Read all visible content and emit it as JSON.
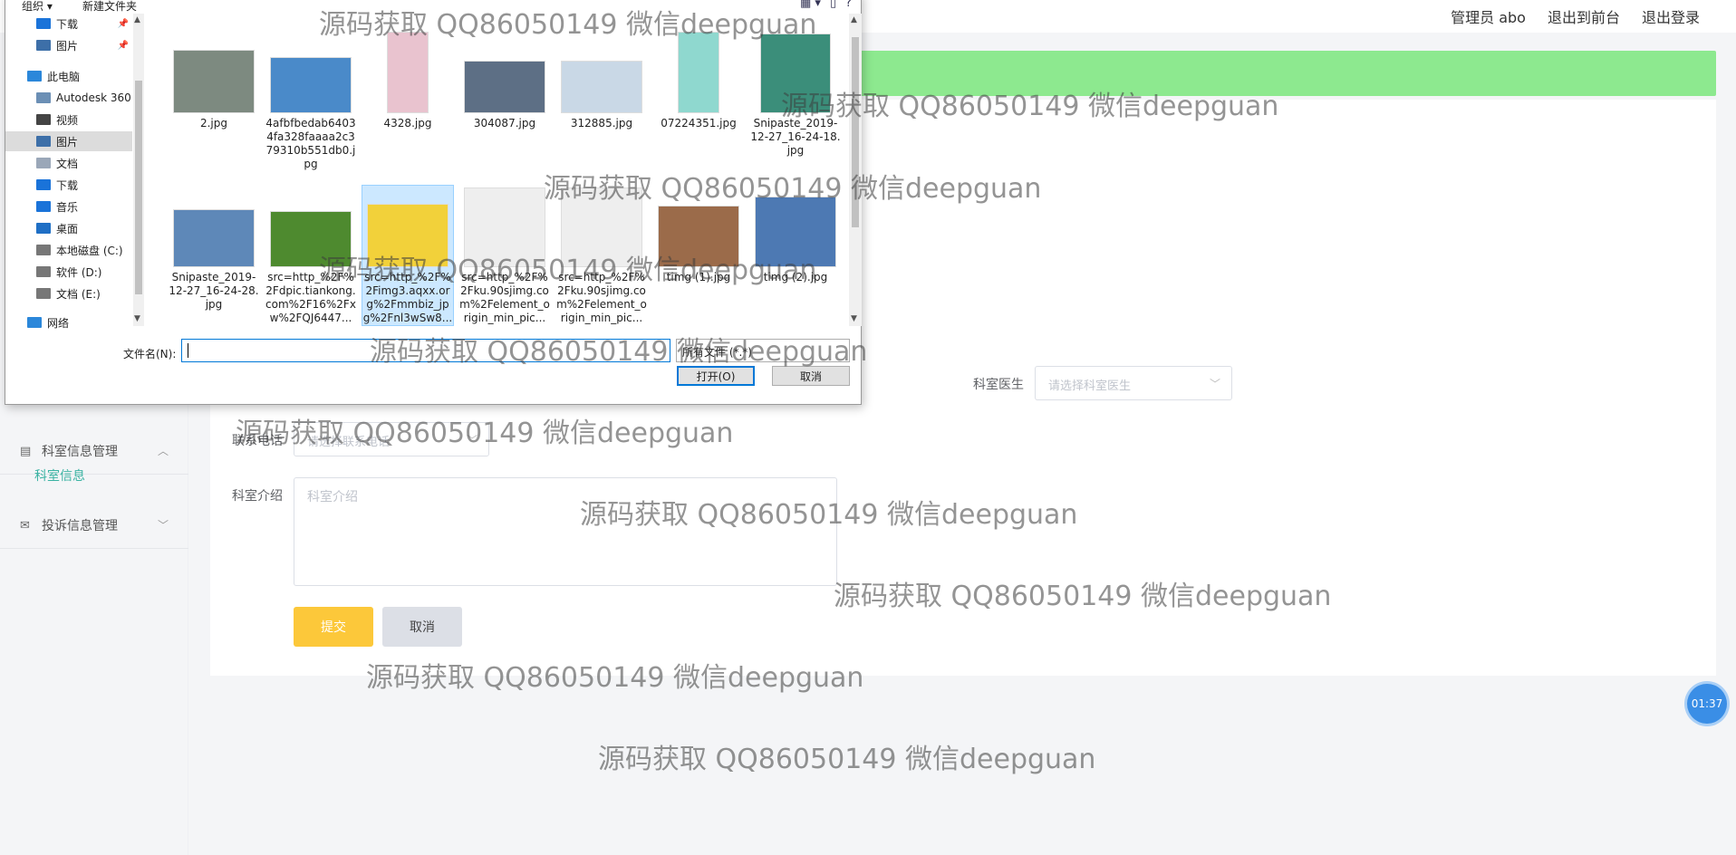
{
  "topbar": {
    "user_label": "管理员 abo",
    "frontend_link": "退出到前台",
    "logout_link": "退出登录"
  },
  "sidebar": {
    "dept_group": "科室信息管理",
    "dept_sub": "科室信息",
    "complaint_group": "投诉信息管理"
  },
  "form": {
    "doctor_label": "科室医生",
    "doctor_placeholder": "请选择科室医生",
    "phone_label": "联系电话",
    "phone_placeholder": "请选择联系电话",
    "intro_label": "科室介绍",
    "intro_placeholder": "科室介绍",
    "submit": "提交",
    "cancel": "取消"
  },
  "timer": "01:37",
  "dialog": {
    "toolbar": {
      "organize": "组织 ▾",
      "new_folder": "新建文件夹"
    },
    "nav": [
      {
        "label": "下载",
        "pinned": true,
        "color": "#1a73d9"
      },
      {
        "label": "图片",
        "pinned": true,
        "color": "#3d6fa8"
      },
      {
        "label": "此电脑",
        "pinned": false,
        "color": "#2b87da"
      },
      {
        "label": "Autodesk 360",
        "pinned": false,
        "color": "#6b8fb5"
      },
      {
        "label": "视频",
        "pinned": false,
        "color": "#444"
      },
      {
        "label": "图片",
        "pinned": false,
        "color": "#3d6fa8",
        "selected": true
      },
      {
        "label": "文档",
        "pinned": false,
        "color": "#9aa7b8"
      },
      {
        "label": "下载",
        "pinned": false,
        "color": "#1a73d9"
      },
      {
        "label": "音乐",
        "pinned": false,
        "color": "#1a73d9"
      },
      {
        "label": "桌面",
        "pinned": false,
        "color": "#1f6fc5"
      },
      {
        "label": "本地磁盘 (C:)",
        "pinned": false,
        "color": "#777"
      },
      {
        "label": "软件 (D:)",
        "pinned": false,
        "color": "#777"
      },
      {
        "label": "文档 (E:)",
        "pinned": false,
        "color": "#777"
      },
      {
        "label": "网络",
        "pinned": false,
        "color": "#2b87da"
      }
    ],
    "files": [
      {
        "name": "2.jpg",
        "color": "#7d8a80"
      },
      {
        "name": "4afbfbedab64034fa328faaaa2c379310b551db0.jpg",
        "color": "#4a8ac9"
      },
      {
        "name": "4328.jpg",
        "color": "#e9c3cf"
      },
      {
        "name": "304087.jpg",
        "color": "#5d6f85"
      },
      {
        "name": "312885.jpg",
        "color": "#c9d8e6"
      },
      {
        "name": "07224351.jpg",
        "color": "#8fd8cf"
      },
      {
        "name": "Snipaste_2019-12-27_16-24-18.jpg",
        "color": "#3b8e7a"
      },
      {
        "name": "Snipaste_2019-12-27_16-24-28.jpg",
        "color": "#5e88b8"
      },
      {
        "name": "src=http_%2F%2Fdpic.tiankong.com%2F16%2Fxw%2FQJ6447...",
        "color": "#4e8a2f"
      },
      {
        "name": "src=http_%2F%2Fimg3.aqxx.org%2Fmmbiz_jpg%2Fnl3wSw8...",
        "color": "#f2d13a"
      },
      {
        "name": "src=http_%2F%2Fku.90sjimg.com%2Felement_origin_min_pic...",
        "color": "#eeeeee"
      },
      {
        "name": "src=http_%2F%2Fku.90sjimg.com%2Felement_origin_min_pic...",
        "color": "#eeeeee"
      },
      {
        "name": "timg (1).jpg",
        "color": "#9b6b4a"
      },
      {
        "name": "timg (2).jpg",
        "color": "#4d79b3"
      }
    ],
    "filename_label": "文件名(N):",
    "filename_value": "",
    "filter": "所有文件 (*.*)",
    "open_button": "打开(O)",
    "cancel_button": "取消"
  },
  "watermark": "源码获取 QQ86050149 微信deepguan"
}
